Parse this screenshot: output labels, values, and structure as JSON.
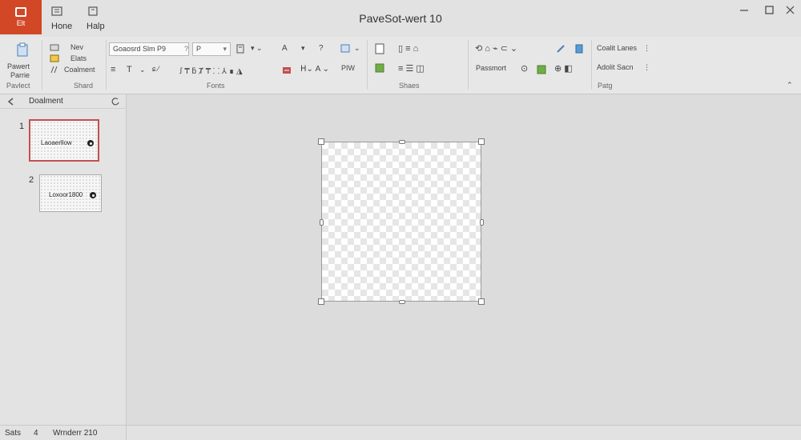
{
  "app": {
    "title": "PaveSot-wert 10",
    "app_button_label": "Elt",
    "accent_color": "#d24726"
  },
  "tabs": [
    {
      "label": "Hone"
    },
    {
      "label": "Halp"
    }
  ],
  "ribbon": {
    "paste_group": {
      "label_line1": "Pawert",
      "label_line2": "Parrie",
      "label_line3": "Pavlect"
    },
    "shared_group": {
      "title": "Shard",
      "items": [
        {
          "label": "Nev",
          "icon": "new-slide-icon"
        },
        {
          "label": "Elats",
          "icon": "layout-icon"
        },
        {
          "label": "Coalment",
          "icon": "comment-icon"
        }
      ]
    },
    "fonts_group": {
      "title": "Fonts",
      "font_name": "Goaosrd Slm P9",
      "font_size": "P"
    },
    "shapes_group": {
      "title": "Shaes",
      "pw_label": "PIW",
      "password_label": "Passmort"
    },
    "page_group": {
      "title": "Patg",
      "item1": "Coalit Lanes",
      "item2": "Adolit Sacn"
    }
  },
  "panel": {
    "title": "Doalment",
    "slides": [
      {
        "number": "1",
        "caption": "Laoaerllow",
        "selected": true
      },
      {
        "number": "2",
        "caption": "Loxoor1800",
        "selected": false
      }
    ]
  },
  "status": {
    "slides_label": "Sats",
    "slides_count": "4",
    "view_label": "Wrnderr 210"
  }
}
